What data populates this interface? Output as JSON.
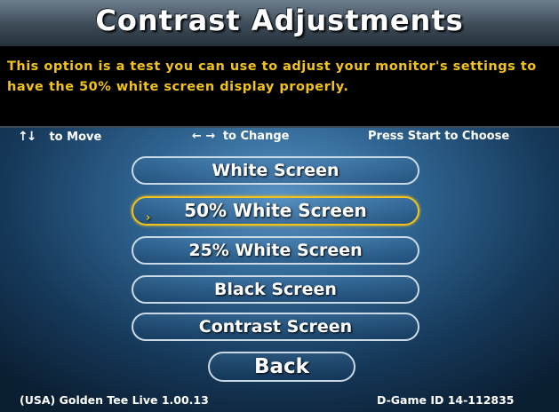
{
  "header": {
    "title": "Contrast Adjustments"
  },
  "description": "This option is a test you can use to adjust your monitor's settings to have the 50% white screen display properly.",
  "instructions": {
    "move_arrows": "↑↓",
    "move_text": "to Move",
    "change_arrows": "← →",
    "change_text": "to Change",
    "choose_text": "Press Start to Choose"
  },
  "menu": {
    "items": [
      {
        "label": "White Screen"
      },
      {
        "label": "50% White Screen"
      },
      {
        "label": "25% White Screen"
      },
      {
        "label": "Black Screen"
      },
      {
        "label": "Contrast Screen"
      },
      {
        "label": "Back"
      }
    ],
    "selected_index": 1,
    "cursor_glyph": "›"
  },
  "footer": {
    "left": "(USA) Golden Tee Live 1.00.13",
    "right": "D-Game ID 14-112835"
  },
  "colors": {
    "accent_yellow": "#f2c31a",
    "button_border": "#c9d9e6",
    "text_white": "#ffffff"
  }
}
